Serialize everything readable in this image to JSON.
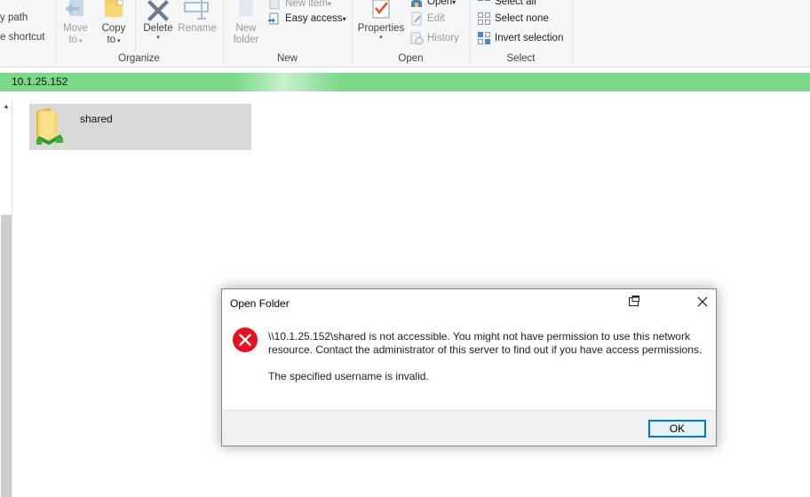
{
  "ribbon": {
    "clipboard_items": [
      "y path",
      "e shortcut"
    ],
    "organize": {
      "move_to": [
        "Move",
        "to"
      ],
      "copy_to": [
        "Copy",
        "to"
      ],
      "delete": "Delete",
      "rename": "Rename",
      "label": "Organize"
    },
    "new": {
      "new_folder": [
        "New",
        "folder"
      ],
      "new_item": "New item",
      "easy_access": "Easy access",
      "label": "New"
    },
    "open": {
      "properties": "Properties",
      "open": "Open",
      "edit": "Edit",
      "history": "History",
      "label": "Open"
    },
    "select": {
      "select_all": "Select all",
      "select_none": "Select none",
      "invert_selection": "Invert selection",
      "label": "Select"
    }
  },
  "address": {
    "path": "10.1.25.152"
  },
  "content": {
    "items": [
      {
        "name": "shared",
        "icon": "network-folder-icon"
      }
    ]
  },
  "dialog": {
    "title": "Open Folder",
    "message": "\\\\10.1.25.152\\shared is not accessible. You might not have permission to use this network resource. Contact the administrator of this server to find out if you have access permissions.",
    "detail": "The specified username is invalid.",
    "ok_label": "OK"
  },
  "colors": {
    "address_bar": "#7bd88a",
    "error_red": "#e81123",
    "ok_border": "#0078d7"
  }
}
